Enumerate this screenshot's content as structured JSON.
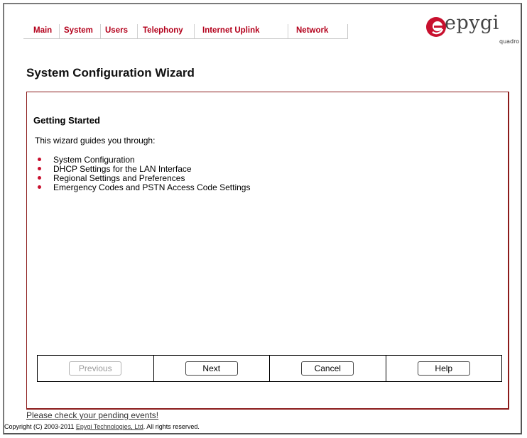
{
  "nav": {
    "items": [
      {
        "label": "Main"
      },
      {
        "label": "System"
      },
      {
        "label": "Users"
      },
      {
        "label": "Telephony"
      },
      {
        "label": "Internet Uplink"
      },
      {
        "label": "Network"
      }
    ]
  },
  "logo": {
    "word": "epygi",
    "sub": "quadro"
  },
  "page": {
    "title": "System Configuration Wizard"
  },
  "wizard": {
    "section_title": "Getting Started",
    "intro": "This wizard guides you through:",
    "bullets": [
      "System Configuration",
      "DHCP Settings for the LAN Interface",
      "Regional Settings and Preferences",
      "Emergency Codes and PSTN Access Code Settings"
    ],
    "buttons": {
      "previous": "Previous",
      "next": "Next",
      "cancel": "Cancel",
      "help": "Help"
    }
  },
  "footer": {
    "pending": "Please check your pending events!",
    "copyright_prefix": "Copyright (C) 2003-2011 ",
    "copyright_link": "Epygi Technologies, Ltd",
    "copyright_suffix": ". All rights reserved."
  },
  "colors": {
    "nav_text": "#b3001b",
    "panel_border": "#8b1a1a",
    "bullet": "#c8102e",
    "logo_red": "#c8102e"
  }
}
